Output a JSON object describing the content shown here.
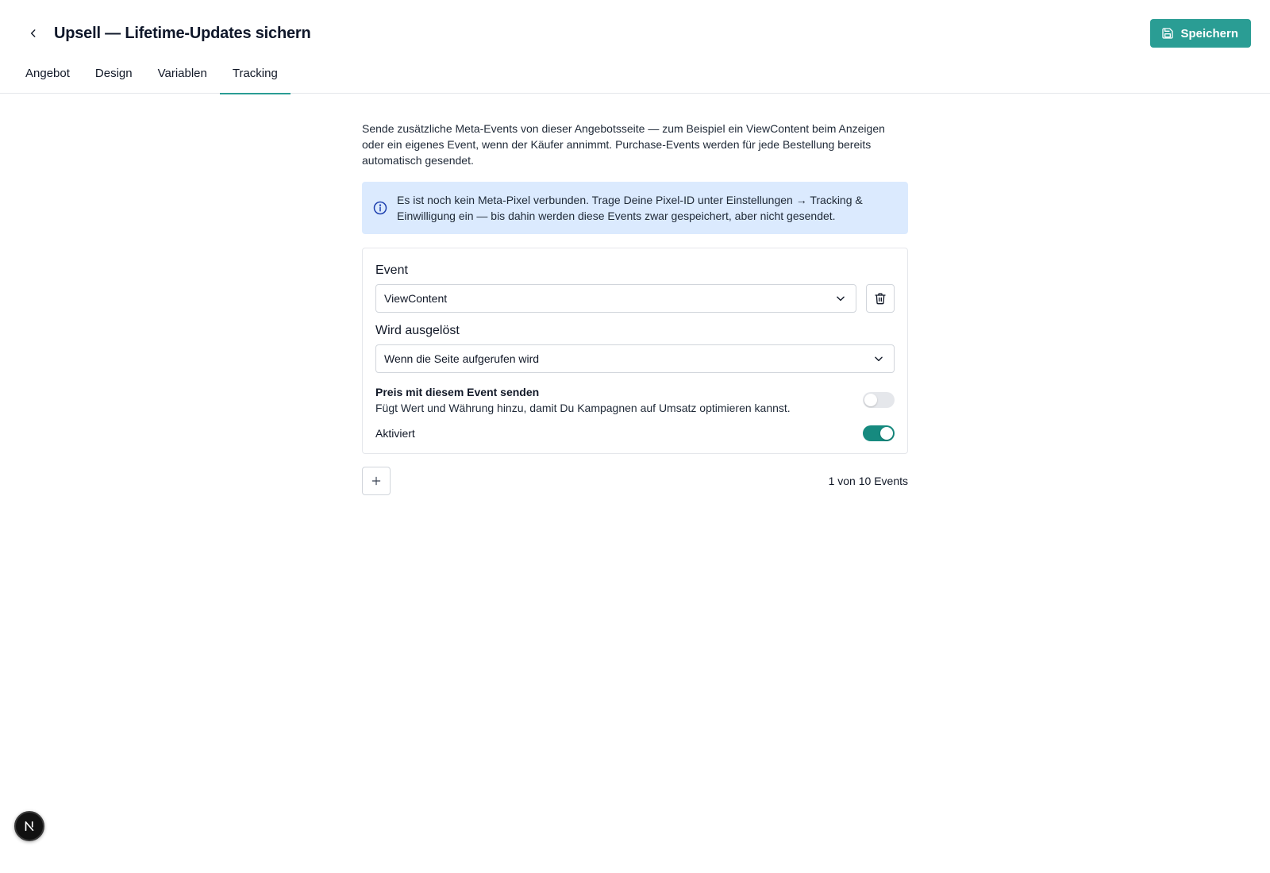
{
  "header": {
    "title": "Upsell — Lifetime-Updates sichern",
    "save_label": "Speichern"
  },
  "tabs": [
    {
      "label": "Angebot",
      "active": false
    },
    {
      "label": "Design",
      "active": false
    },
    {
      "label": "Variablen",
      "active": false
    },
    {
      "label": "Tracking",
      "active": true
    }
  ],
  "intro": "Sende zusätzliche Meta-Events von dieser Angebotsseite — zum Beispiel ein ViewContent beim Anzeigen oder ein eigenes Event, wenn der Käufer annimmt. Purchase-Events werden für jede Bestellung bereits automatisch gesendet.",
  "info_box": {
    "text": "Es ist noch kein Meta-Pixel verbunden. Trage Deine Pixel-ID unter Einstellungen → Tracking & Einwilligung ein — bis dahin werden diese Events zwar gespeichert, aber nicht gesendet."
  },
  "event_card": {
    "event_label": "Event",
    "event_value": "ViewContent",
    "trigger_label": "Wird ausgelöst",
    "trigger_value": "Wenn die Seite aufgerufen wird",
    "price_title": "Preis mit diesem Event senden",
    "price_desc": "Fügt Wert und Währung hinzu, damit Du Kampagnen auf Umsatz optimieren kannst.",
    "price_enabled": false,
    "active_label": "Aktiviert",
    "active_enabled": true
  },
  "footer": {
    "count_text": "1 von 10 Events"
  },
  "colors": {
    "accent": "#2a9d94",
    "toggle_on": "#168a7f",
    "info_bg": "#dbeafe",
    "info_icon": "#1e40af"
  },
  "icons": {
    "back": "chevron-left-icon",
    "save": "floppy-disk-icon",
    "info": "info-circle-icon",
    "dropdown": "chevron-down-icon",
    "delete": "trash-icon",
    "add": "plus-icon",
    "badge": "next-logo-icon"
  }
}
